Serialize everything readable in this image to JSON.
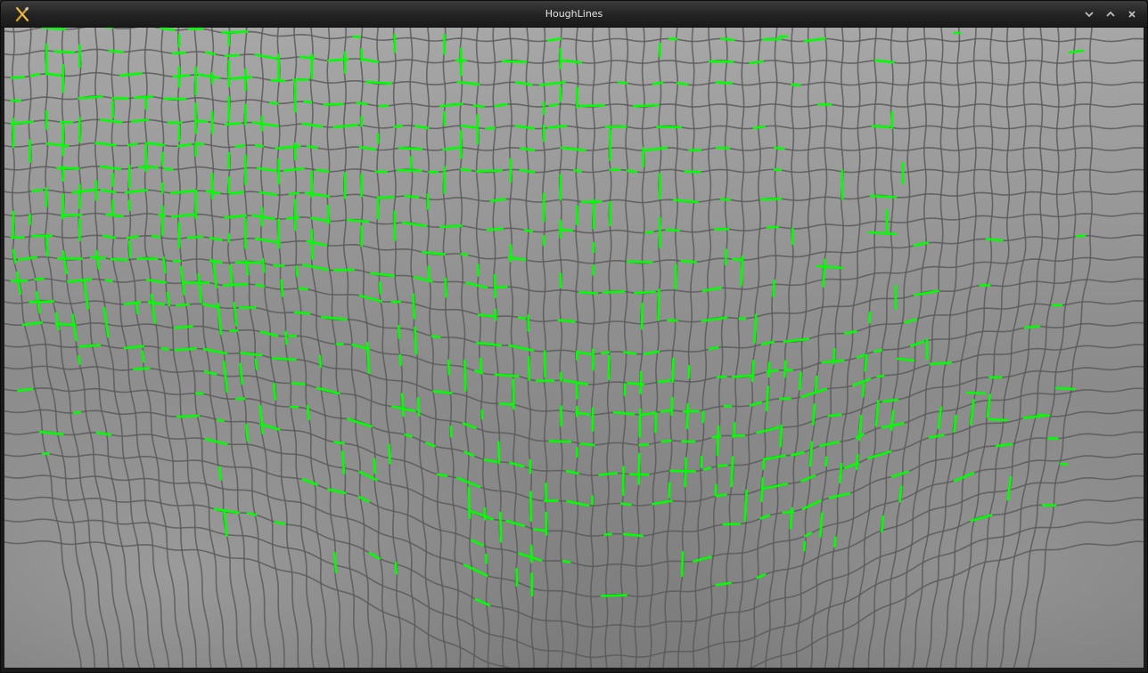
{
  "window": {
    "title": "HoughLines",
    "app_icon": "x-tools-icon",
    "controls": [
      {
        "name": "minimize-button",
        "icon": "chevron-down-icon"
      },
      {
        "name": "maximize-button",
        "icon": "chevron-up-icon"
      },
      {
        "name": "close-button",
        "icon": "close-icon"
      }
    ]
  },
  "image": {
    "subject": "fishing-net",
    "overlay_color": "#00ff00",
    "net_color": "#5a5a5a"
  }
}
